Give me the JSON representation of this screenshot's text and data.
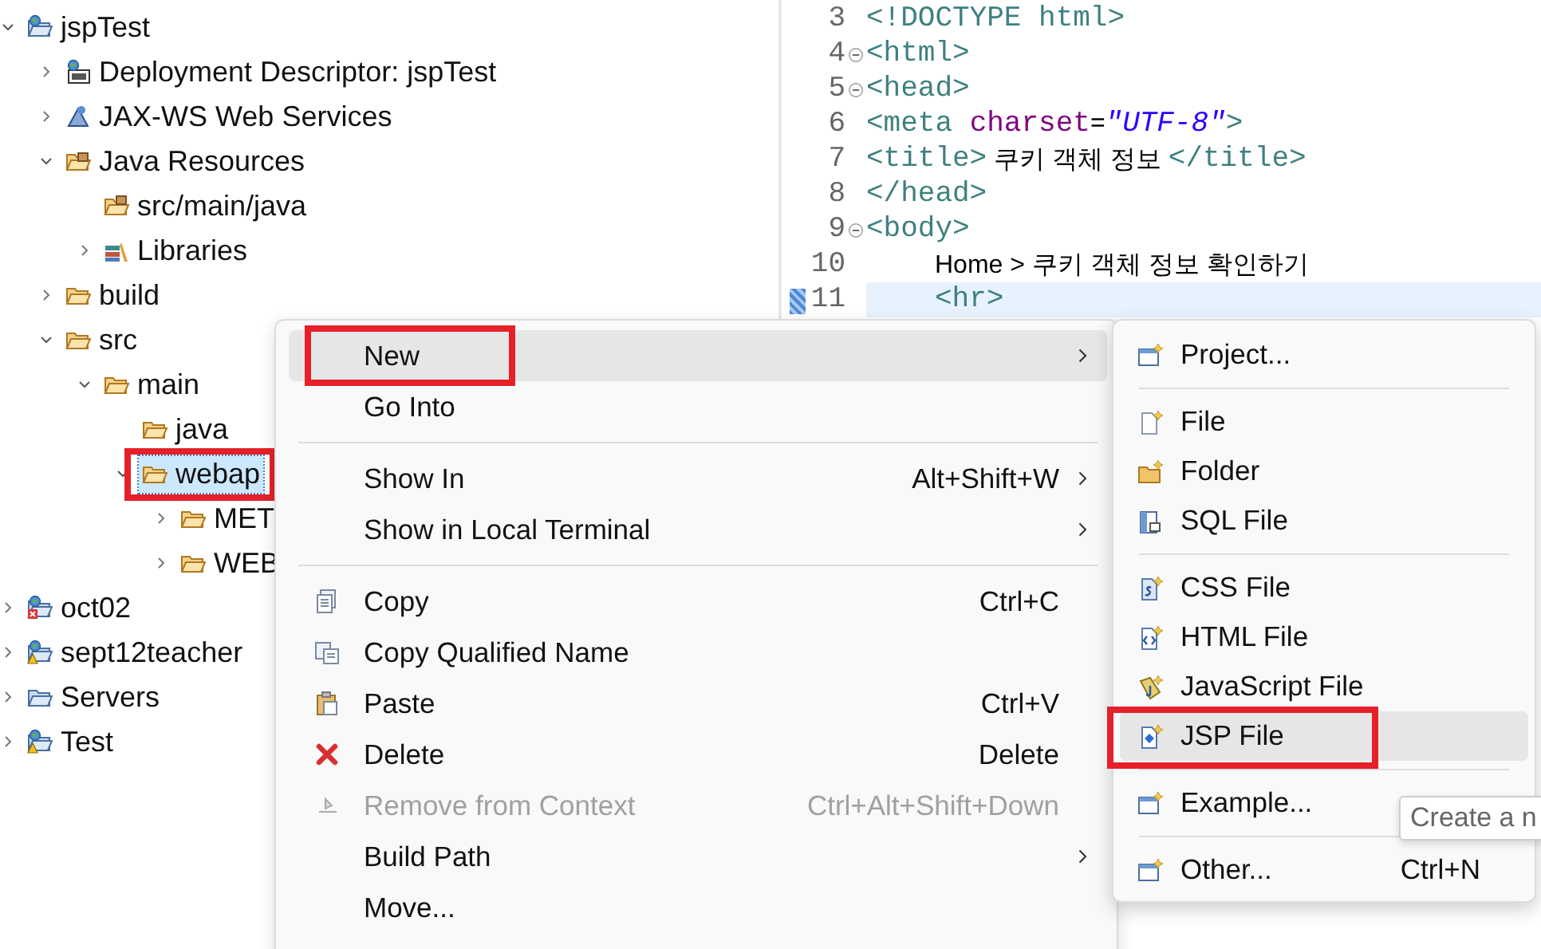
{
  "explorer": {
    "items": [
      {
        "label": "jspTest",
        "kind": "project",
        "expanded": true,
        "selected": false,
        "annotated": false,
        "children": [
          {
            "label": "Deployment Descriptor: jspTest",
            "kind": "descriptor",
            "expanded": false,
            "selected": false,
            "annotated": false
          },
          {
            "label": "JAX-WS Web Services",
            "kind": "webservices",
            "expanded": false,
            "selected": false,
            "annotated": false
          },
          {
            "label": "Java Resources",
            "kind": "javares",
            "expanded": true,
            "selected": false,
            "annotated": false,
            "children": [
              {
                "label": "src/main/java",
                "kind": "srcfolder",
                "selected": false,
                "annotated": false
              },
              {
                "label": "Libraries",
                "kind": "libraries",
                "expanded": false,
                "selected": false,
                "annotated": false
              }
            ]
          },
          {
            "label": "build",
            "kind": "folder",
            "expanded": false,
            "selected": false,
            "annotated": false
          },
          {
            "label": "src",
            "kind": "folder",
            "expanded": true,
            "selected": false,
            "annotated": false,
            "children": [
              {
                "label": "main",
                "kind": "folder",
                "expanded": true,
                "selected": false,
                "annotated": false,
                "children": [
                  {
                    "label": "java",
                    "kind": "folder",
                    "selected": false,
                    "annotated": false
                  },
                  {
                    "label": "webap",
                    "kind": "folder",
                    "expanded": true,
                    "selected": true,
                    "annotated": true,
                    "children": [
                      {
                        "label": "MET",
                        "kind": "folder",
                        "expanded": false,
                        "selected": false,
                        "annotated": false
                      },
                      {
                        "label": "WEB",
                        "kind": "folder",
                        "expanded": false,
                        "selected": false,
                        "annotated": false
                      }
                    ]
                  }
                ]
              }
            ]
          }
        ]
      },
      {
        "label": "oct02",
        "kind": "project-error",
        "expanded": false,
        "selected": false,
        "annotated": false
      },
      {
        "label": "sept12teacher",
        "kind": "project-warning",
        "expanded": false,
        "selected": false,
        "annotated": false
      },
      {
        "label": "Servers",
        "kind": "servers",
        "expanded": false,
        "selected": false,
        "annotated": false
      },
      {
        "label": "Test",
        "kind": "project-warning",
        "expanded": false,
        "selected": false,
        "annotated": false
      }
    ]
  },
  "editor": {
    "lines": [
      {
        "number": "3",
        "fold": false,
        "indented": false,
        "current": false,
        "tokens": [
          {
            "kind": "tag",
            "text": "<!DOCTYPE html>"
          }
        ]
      },
      {
        "number": "4",
        "fold": true,
        "indented": false,
        "current": false,
        "tokens": [
          {
            "kind": "tag",
            "text": "<html>"
          }
        ]
      },
      {
        "number": "5",
        "fold": true,
        "indented": false,
        "current": false,
        "tokens": [
          {
            "kind": "tag",
            "text": "<head>"
          }
        ]
      },
      {
        "number": "6",
        "fold": false,
        "indented": false,
        "current": false,
        "tokens": [
          {
            "kind": "tag",
            "text": "<meta "
          },
          {
            "kind": "attr",
            "text": "charset"
          },
          {
            "kind": "text",
            "text": "="
          },
          {
            "kind": "value",
            "text": "\"UTF-8\""
          },
          {
            "kind": "tag",
            "text": ">"
          }
        ]
      },
      {
        "number": "7",
        "fold": false,
        "indented": false,
        "current": false,
        "tokens": [
          {
            "kind": "tag",
            "text": "<title>"
          },
          {
            "kind": "text",
            "text": " 쿠키 객체 정보 "
          },
          {
            "kind": "tag",
            "text": "</title>"
          }
        ]
      },
      {
        "number": "8",
        "fold": false,
        "indented": false,
        "current": false,
        "tokens": [
          {
            "kind": "tag",
            "text": "</head>"
          }
        ]
      },
      {
        "number": "9",
        "fold": true,
        "indented": false,
        "current": false,
        "tokens": [
          {
            "kind": "tag",
            "text": "<body>"
          }
        ]
      },
      {
        "number": "10",
        "fold": false,
        "indented": true,
        "current": false,
        "tokens": [
          {
            "kind": "text",
            "text": "Home > 쿠키 객체 정보 확인하기"
          }
        ]
      },
      {
        "number": "11",
        "fold": false,
        "indented": true,
        "current": true,
        "tokens": [
          {
            "kind": "tag",
            "text": "<hr>"
          }
        ]
      }
    ]
  },
  "context_menu": {
    "groups": [
      [
        {
          "label": "New",
          "kind": "plain",
          "submenu": true,
          "selected": true,
          "disabled": false,
          "annotated": true
        },
        {
          "label": "Go Into",
          "kind": "plain",
          "submenu": false,
          "selected": false,
          "disabled": false,
          "annotated": false
        }
      ],
      [
        {
          "label": "Show In",
          "shortcut": "Alt+Shift+W",
          "kind": "plain",
          "submenu": true,
          "selected": false,
          "disabled": false,
          "annotated": false
        },
        {
          "label": "Show in Local Terminal",
          "kind": "plain",
          "submenu": true,
          "selected": false,
          "disabled": false,
          "annotated": false
        }
      ],
      [
        {
          "label": "Copy",
          "shortcut": "Ctrl+C",
          "kind": "copy",
          "submenu": false,
          "selected": false,
          "disabled": false,
          "annotated": false
        },
        {
          "label": "Copy Qualified Name",
          "kind": "copyname",
          "submenu": false,
          "selected": false,
          "disabled": false,
          "annotated": false
        },
        {
          "label": "Paste",
          "shortcut": "Ctrl+V",
          "kind": "paste",
          "submenu": false,
          "selected": false,
          "disabled": false,
          "annotated": false
        },
        {
          "label": "Delete",
          "shortcut": "Delete",
          "kind": "delete",
          "submenu": false,
          "selected": false,
          "disabled": false,
          "annotated": false
        },
        {
          "label": "Remove from Context",
          "shortcut": "Ctrl+Alt+Shift+Down",
          "kind": "remove",
          "submenu": false,
          "selected": false,
          "disabled": true,
          "annotated": false
        },
        {
          "label": "Build Path",
          "kind": "plain",
          "submenu": true,
          "selected": false,
          "disabled": false,
          "annotated": false
        },
        {
          "label": "Move...",
          "kind": "plain",
          "submenu": false,
          "selected": false,
          "disabled": false,
          "annotated": false
        }
      ]
    ]
  },
  "new_submenu": {
    "groups": [
      [
        {
          "label": "Project...",
          "kind": "project",
          "selected": false,
          "annotated": false
        }
      ],
      [
        {
          "label": "File",
          "kind": "file",
          "selected": false,
          "annotated": false
        },
        {
          "label": "Folder",
          "kind": "folder",
          "selected": false,
          "annotated": false
        },
        {
          "label": "SQL File",
          "kind": "sql",
          "selected": false,
          "annotated": false
        }
      ],
      [
        {
          "label": "CSS File",
          "kind": "css",
          "selected": false,
          "annotated": false
        },
        {
          "label": "HTML File",
          "kind": "html",
          "selected": false,
          "annotated": false
        },
        {
          "label": "JavaScript File",
          "kind": "js",
          "selected": false,
          "annotated": false
        },
        {
          "label": "JSP File",
          "kind": "jsp",
          "selected": true,
          "annotated": true
        }
      ],
      [
        {
          "label": "Example...",
          "kind": "project",
          "selected": false,
          "annotated": false
        }
      ],
      [
        {
          "label": "Other...",
          "shortcut": "Ctrl+N",
          "kind": "project",
          "selected": false,
          "annotated": false
        }
      ]
    ]
  },
  "tooltip": {
    "text": "Create a n"
  }
}
